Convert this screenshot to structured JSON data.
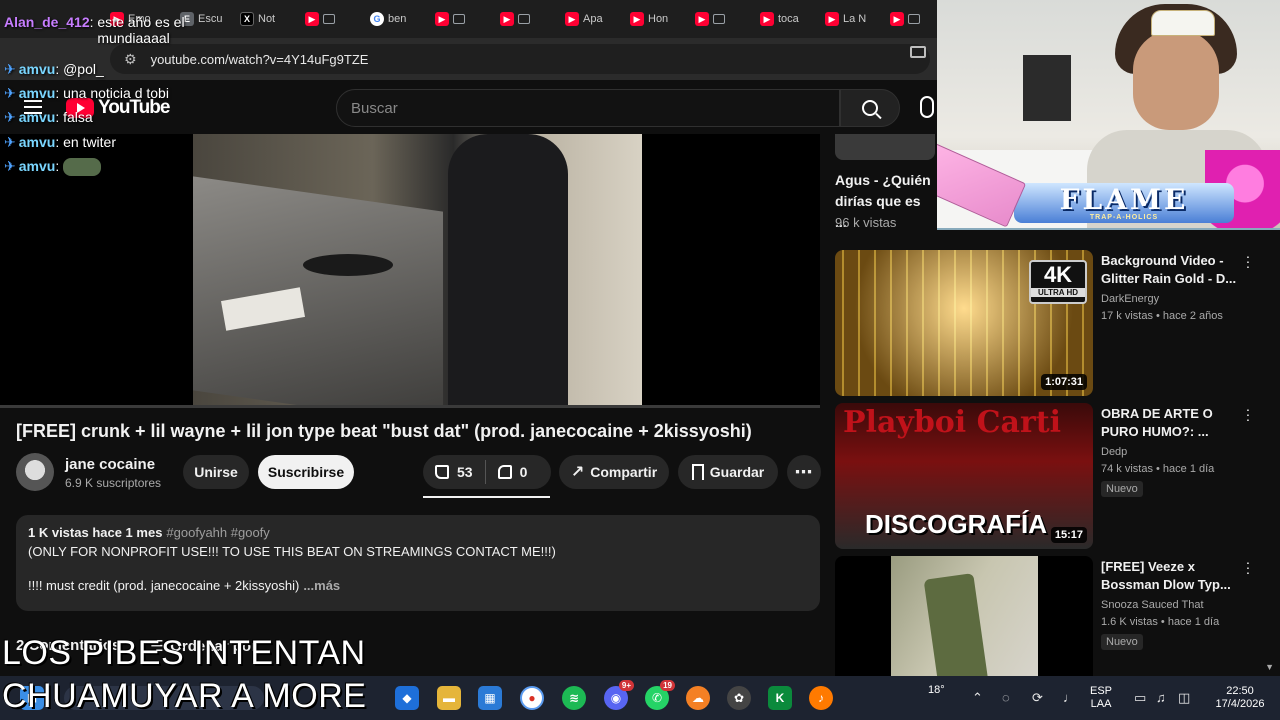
{
  "browser": {
    "tabs": [
      {
        "icon": "youtube-icon",
        "label": "Emo"
      },
      {
        "icon": "tab-icon",
        "label": "Escu"
      },
      {
        "icon": "x-icon",
        "label": "Not"
      },
      {
        "icon": "google-icon",
        "label": "ben"
      },
      {
        "icon": "youtube-icon",
        "label": "Apa"
      },
      {
        "icon": "youtube-icon",
        "label": "Hon"
      },
      {
        "icon": "youtube-icon",
        "label": "toca"
      },
      {
        "icon": "youtube-icon",
        "label": "La N"
      }
    ],
    "url": "youtube.com/watch?v=4Y14uFg9TZE"
  },
  "youtube": {
    "logo_text": "YouTube",
    "search_placeholder": "Buscar",
    "video": {
      "title": "[FREE] crunk + lil wayne + lil jon type beat \"bust dat\" (prod. janecocaine + 2kissyoshi)",
      "channel": "jane cocaine",
      "subscribers": "6.9 K suscriptores",
      "join_label": "Unirse",
      "subscribe_label": "Suscribirse",
      "likes": "53",
      "dislikes": "0",
      "share_label": "Compartir",
      "save_label": "Guardar",
      "stats": "1 K vistas  hace 1 mes",
      "tags": "#goofyahh #goofy",
      "desc_line1": "(ONLY FOR NONPROFIT USE!!! TO USE THIS BEAT ON STREAMINGS CONTACT ME!!!)",
      "desc_line2": "!!!! must credit (prod. janecocaine + 2kissyoshi)",
      "more_label": "...más",
      "comments_count": "2 Comentarios",
      "sort_label": "Ordenar por"
    },
    "sidebar": {
      "partial_item": {
        "title": "Agus - ¿Quién dirías que es ...",
        "views": "96 k vistas"
      },
      "items": [
        {
          "title": "Background Video - Glitter Rain Gold - D...",
          "channel": "DarkEnergy",
          "meta": "17 k vistas • hace 2 años",
          "duration": "1:07:31",
          "badge": "",
          "thumb_text_big": "4K",
          "thumb_text_small": "ULTRA HD"
        },
        {
          "title": "OBRA DE ARTE O PURO HUMO?: ...",
          "channel": "Dedp",
          "meta": "74 k vistas • hace 1 día",
          "duration": "15:17",
          "badge": "Nuevo",
          "thumb_text_big": "DISCOGRAFÍA",
          "thumb_text_small": "Playboi Carti"
        },
        {
          "title": "[FREE] Veeze x Bossman Dlow Typ...",
          "channel": "Snooza Sauced That",
          "meta": "1.6 K vistas • hace 1 día",
          "duration": "",
          "badge": "Nuevo"
        }
      ]
    }
  },
  "chat": [
    {
      "user": "Alan_de_412",
      "message": "este año es el mundiaaaal"
    },
    {
      "user": "amvu",
      "message": "@pol_"
    },
    {
      "user": "amvu",
      "message": "una noticia d tobi"
    },
    {
      "user": "amvu",
      "message": "falsa"
    },
    {
      "user": "amvu",
      "message": "en twiter"
    },
    {
      "user": "amvu",
      "message": ""
    }
  ],
  "captions": [
    "LOS PIBES INTENTAN",
    "CHUAMUYAR A MORE"
  ],
  "webcam": {
    "logo_text": "FLAME",
    "logo_subtext": "TRAP-A-HOLICS"
  },
  "taskbar": {
    "weather": "18°",
    "language": [
      "ESP",
      "LAA"
    ],
    "time": "22:50",
    "date": "17/4/2026",
    "discord_badge": "9+",
    "whatsapp_badge": "19"
  }
}
